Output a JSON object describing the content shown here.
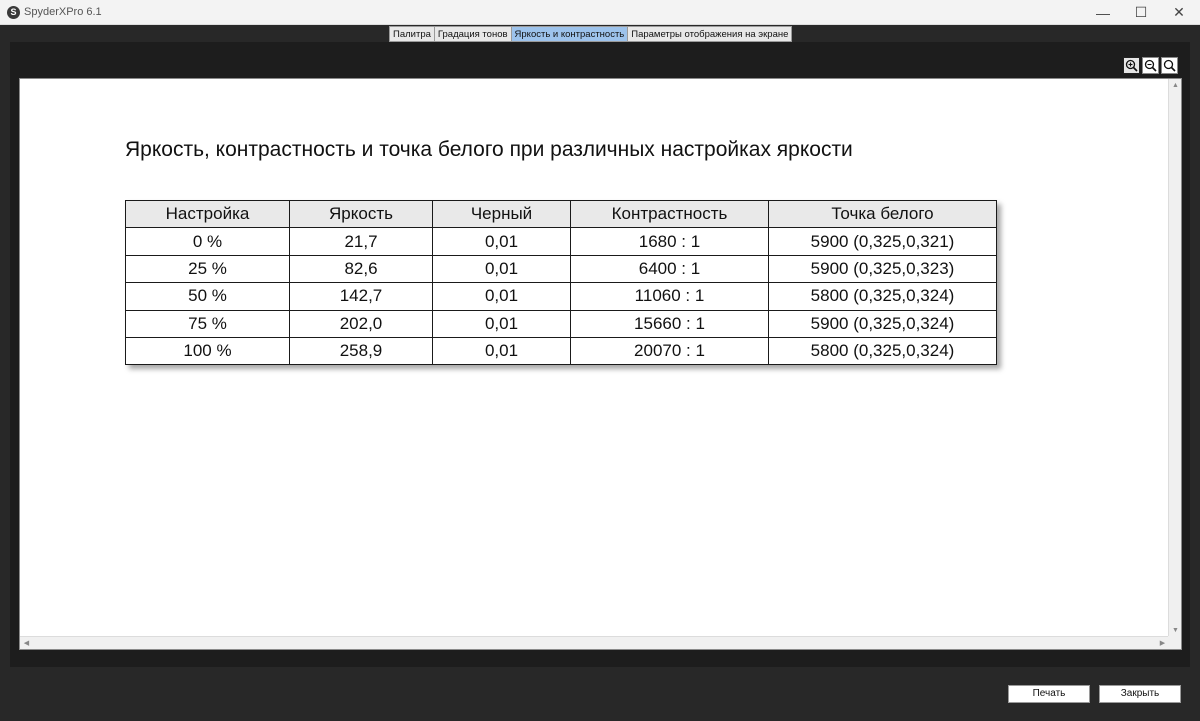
{
  "window": {
    "title": "SpyderXPro 6.1",
    "app_icon_letter": "S",
    "controls": {
      "minimize": "—",
      "maximize": "☐",
      "close": "✕"
    }
  },
  "tabs": [
    {
      "label": "Палитра",
      "active": false
    },
    {
      "label": "Градация тонов",
      "active": false
    },
    {
      "label": "Яркость и контрастность",
      "active": true
    },
    {
      "label": "Параметры отображения на экране",
      "active": false
    }
  ],
  "zoom_tools": [
    "zoom-in-icon",
    "zoom-out-icon",
    "zoom-fit-icon"
  ],
  "report": {
    "title": "Яркость, контрастность и точка белого при различных настройках яркости",
    "columns": [
      "Настройка",
      "Яркость",
      "Черный",
      "Контрастность",
      "Точка белого"
    ],
    "rows": [
      [
        "0 %",
        "21,7",
        "0,01",
        "1680 : 1",
        "5900 (0,325,0,321)"
      ],
      [
        "25 %",
        "82,6",
        "0,01",
        "6400 : 1",
        "5900 (0,325,0,323)"
      ],
      [
        "50 %",
        "142,7",
        "0,01",
        "11060 : 1",
        "5800 (0,325,0,324)"
      ],
      [
        "75 %",
        "202,0",
        "0,01",
        "15660 : 1",
        "5900 (0,325,0,324)"
      ],
      [
        "100 %",
        "258,9",
        "0,01",
        "20070 : 1",
        "5800 (0,325,0,324)"
      ]
    ]
  },
  "footer": {
    "print_label": "Печать",
    "close_label": "Закрыть"
  },
  "colors": {
    "active_tab": "#9dc3ec",
    "background": "#282828"
  }
}
